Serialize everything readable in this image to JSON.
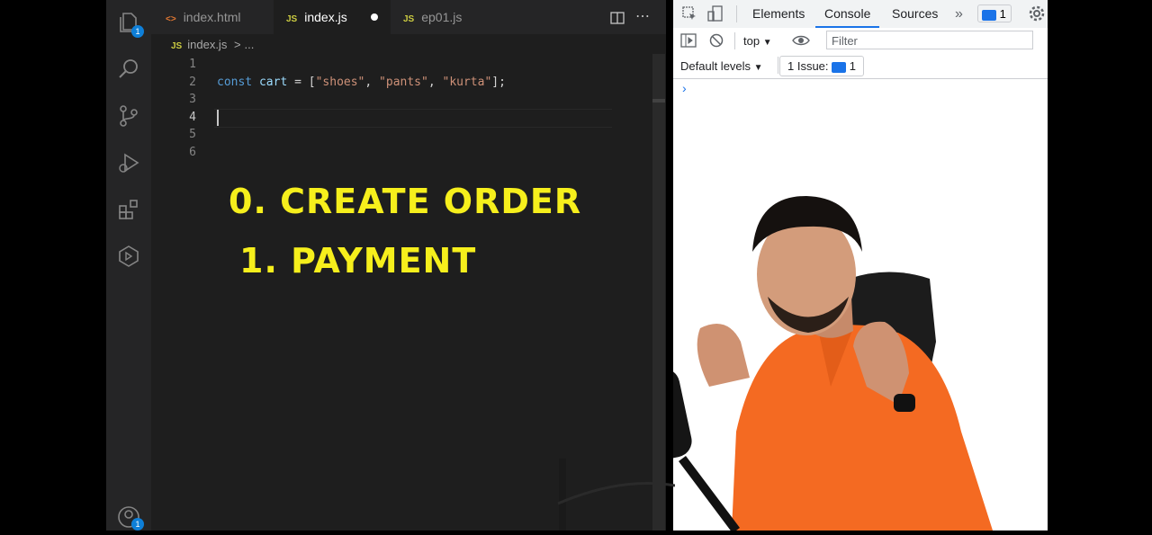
{
  "editor": {
    "tabs": [
      {
        "icon": "<>",
        "label": "index.html"
      },
      {
        "icon": "JS",
        "label": "index.js"
      },
      {
        "icon": "JS",
        "label": "ep01.js"
      }
    ],
    "breadcrumb": {
      "icon": "JS",
      "file": "index.js",
      "sep": ">",
      "rest": "..."
    },
    "line_numbers": [
      "1",
      "2",
      "3",
      "4",
      "5",
      "6"
    ],
    "code": {
      "kw": "const",
      "var": "cart",
      "eq": " = [",
      "s1": "\"shoes\"",
      "c1": ", ",
      "s2": "\"pants\"",
      "c2": ", ",
      "s3": "\"kurta\"",
      "end": "];"
    },
    "activity_badges": {
      "explorer": "1",
      "account": "1"
    }
  },
  "overlay": {
    "line1": "0. CREATE ORDER",
    "line2": "1. PAYMENT"
  },
  "devtools": {
    "tabs": [
      "Elements",
      "Console",
      "Sources"
    ],
    "more": "»",
    "issues_count": "1",
    "context": "top",
    "filter_placeholder": "Filter",
    "levels": "Default levels",
    "issue_text": "1 Issue:",
    "issue_count": "1",
    "prompt": "›"
  },
  "colors": {
    "accent": "#f6ef1c",
    "devtools_blue": "#1a73e8"
  }
}
